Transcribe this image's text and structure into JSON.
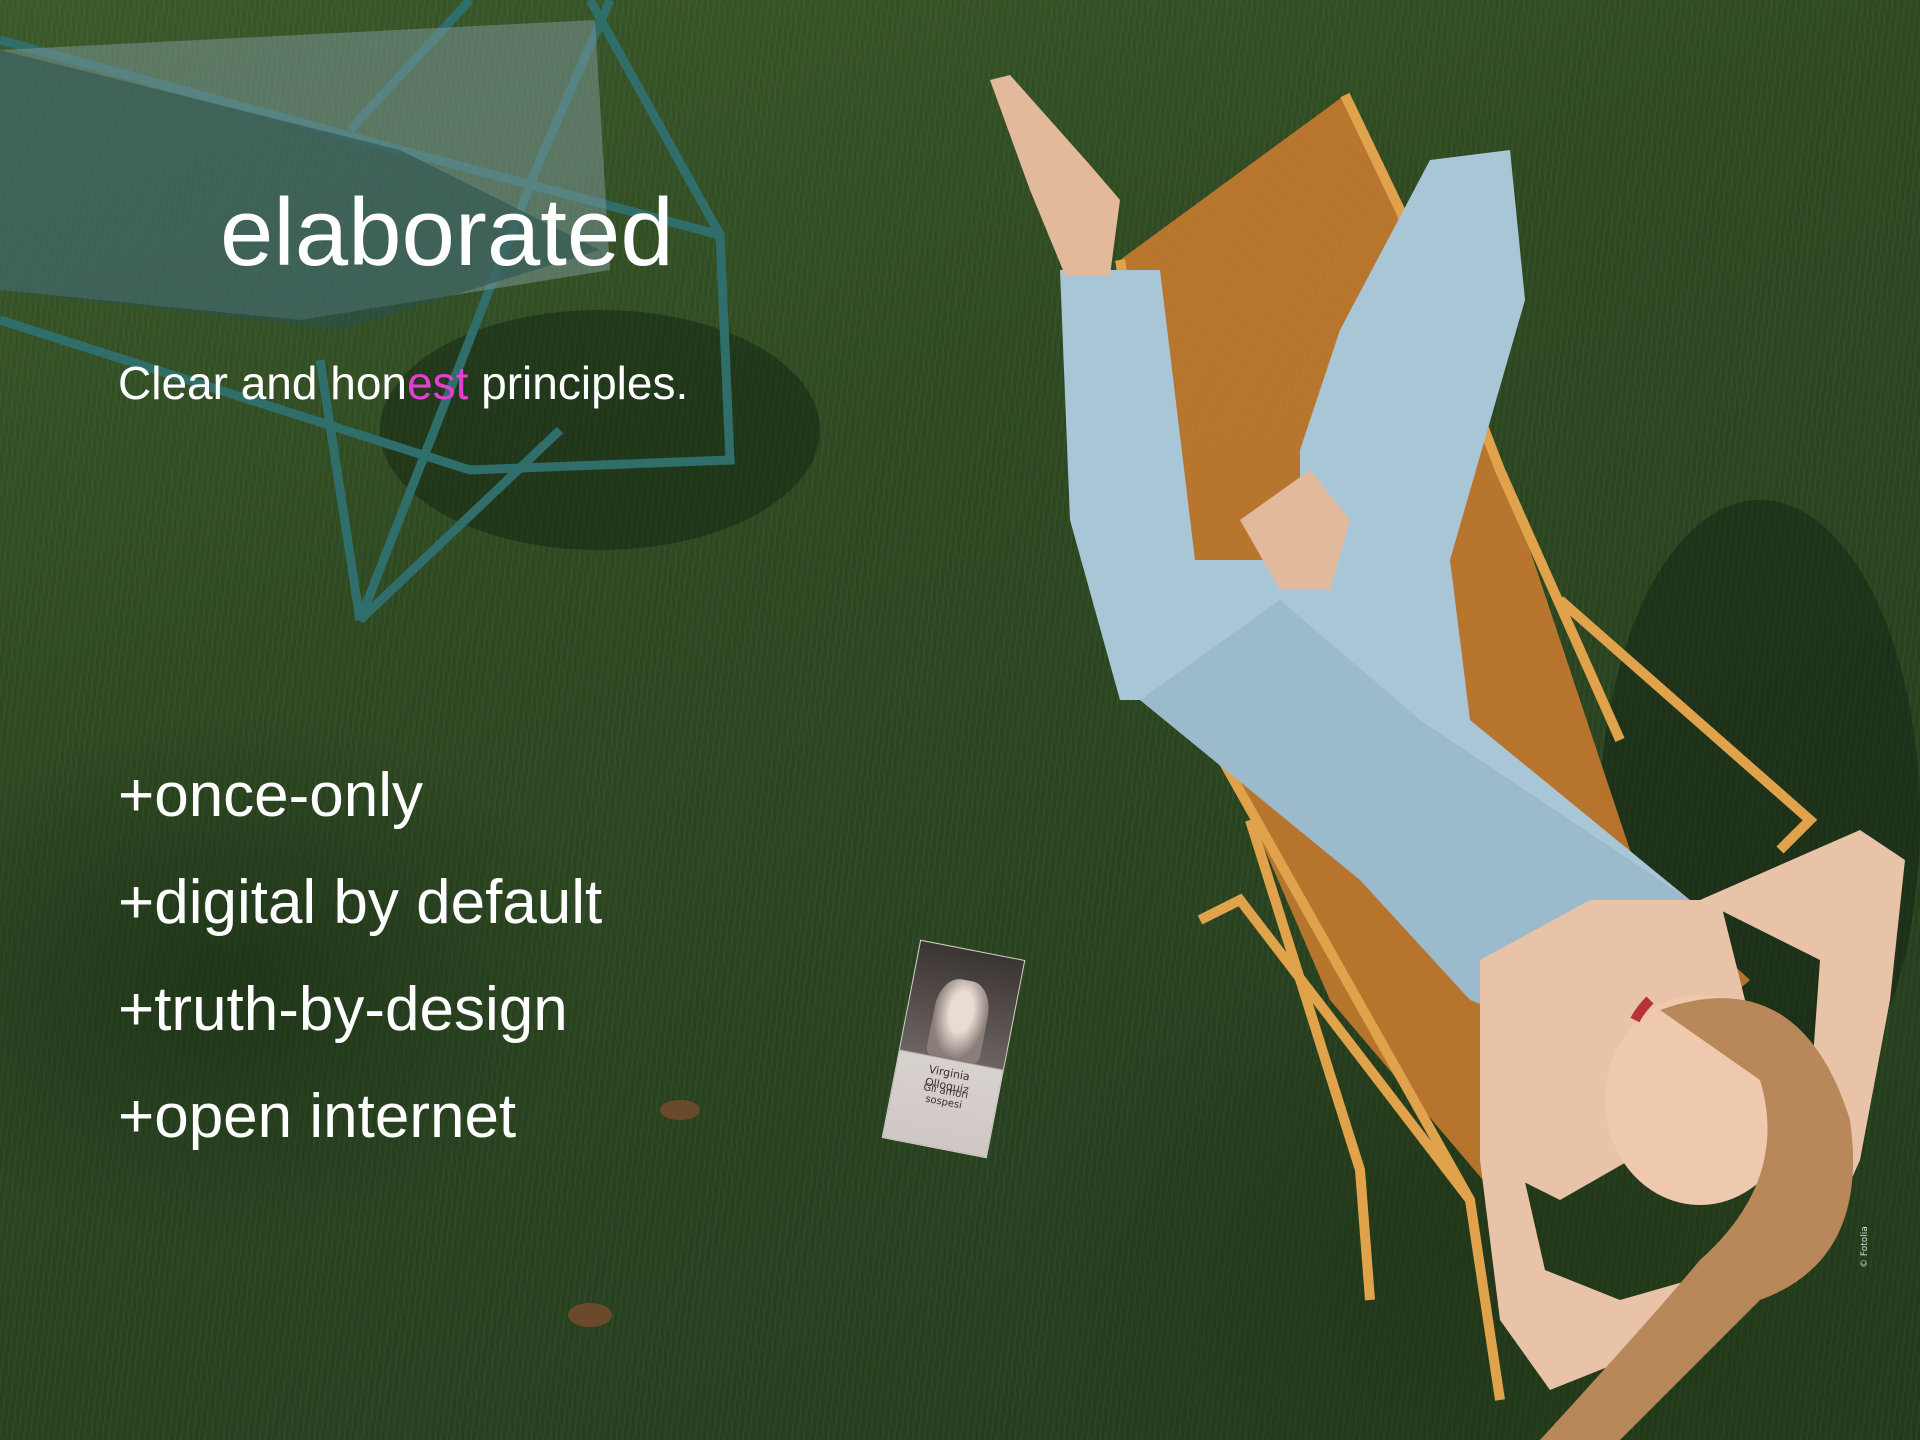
{
  "slide": {
    "title": "elaborated",
    "subtitle_parts": [
      "Clear and  hon",
      "est",
      " principles."
    ],
    "principles": [
      "+once-only",
      "+digital by default",
      "+truth-by-design",
      "+open internet"
    ]
  },
  "book": {
    "author": "Virginia Olloquiz",
    "title": "Gli amori sospesi"
  },
  "credit": "© Fotolia",
  "colors": {
    "text": "#ffffff",
    "accent": "#e53fd2",
    "grass": "#2f4a22",
    "chair_orange": "#d4893a",
    "chair_green": "#3d6b66",
    "outfit": "#a9c6d6"
  }
}
